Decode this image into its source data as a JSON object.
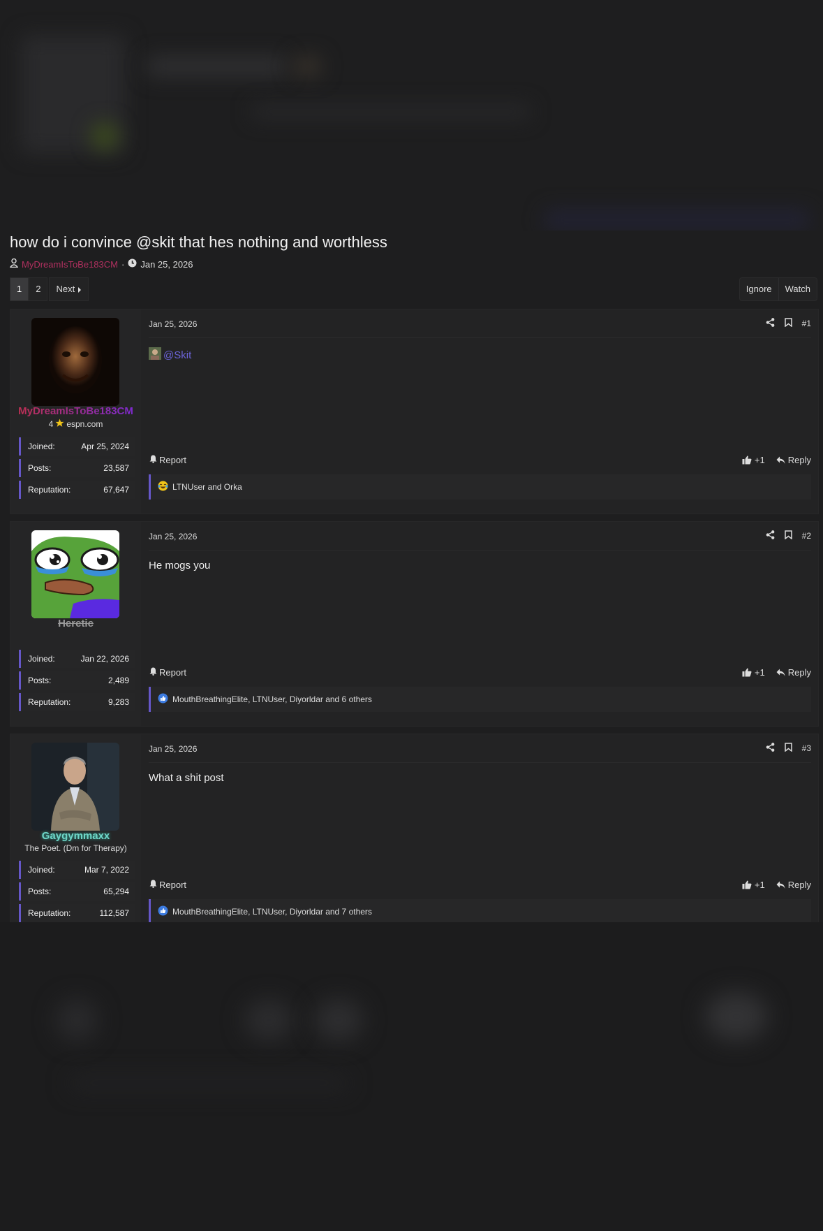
{
  "thread": {
    "title": "how do i convince @skit that hes nothing and worthless",
    "author": "MyDreamIsToBe183CM",
    "date": "Jan 25, 2026",
    "separator": "·"
  },
  "pager": {
    "pages": [
      "1",
      "2"
    ],
    "next_label": "Next"
  },
  "thread_actions": {
    "ignore": "Ignore",
    "watch": "Watch"
  },
  "posts": [
    {
      "number": "#1",
      "date": "Jan 25, 2026",
      "username": "MyDreamIsToBe183CM",
      "user_title_count": "4",
      "user_title_text": "espn.com",
      "stats": {
        "joined_label": "Joined:",
        "joined": "Apr 25, 2024",
        "posts_label": "Posts:",
        "posts": "23,587",
        "rep_label": "Reputation:",
        "rep": "67,647"
      },
      "mention": "@Skit",
      "report": "Report",
      "like": "+1",
      "reply": "Reply",
      "reactions": "LTNUser and Orka"
    },
    {
      "number": "#2",
      "date": "Jan 25, 2026",
      "username": "Heretic",
      "stats": {
        "joined_label": "Joined:",
        "joined": "Jan 22, 2026",
        "posts_label": "Posts:",
        "posts": "2,489",
        "rep_label": "Reputation:",
        "rep": "9,283"
      },
      "content": "He mogs you",
      "report": "Report",
      "like": "+1",
      "reply": "Reply",
      "reactions": "MouthBreathingElite, LTNUser, Diyorldar and 6 others"
    },
    {
      "number": "#3",
      "date": "Jan 25, 2026",
      "username": "Gaygymmaxx",
      "user_title": "The Poet. (Dm for Therapy)",
      "stats": {
        "joined_label": "Joined:",
        "joined": "Mar 7, 2022",
        "posts_label": "Posts:",
        "posts": "65,294",
        "rep_label": "Reputation:",
        "rep": "112,587"
      },
      "content": "What a shit post",
      "report": "Report",
      "like": "+1",
      "reply": "Reply",
      "reactions": "MouthBreathingElite, LTNUser, Diyorldar and 7 others"
    }
  ],
  "colors": {
    "accent": "#6657c9",
    "author_gradient_start": "#c0304a",
    "author_gradient_end": "#7a2ad8",
    "heretic_name": "#9a9a9a",
    "gaygym_name": "#6fd6c8"
  },
  "icons": [
    "user-icon",
    "clock-icon",
    "share-icon",
    "bookmark-icon",
    "bell-icon",
    "thumbs-up-icon",
    "reply-icon",
    "star-icon",
    "laugh-icon",
    "like-icon",
    "caret-right-icon"
  ]
}
